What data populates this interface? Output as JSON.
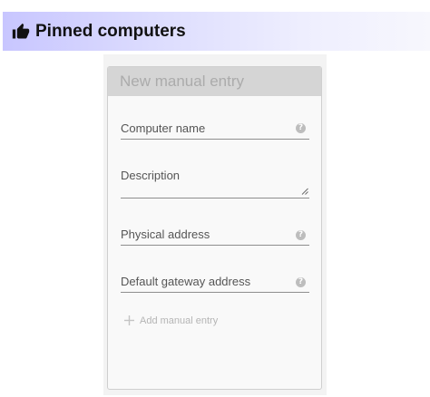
{
  "header": {
    "title": "Pinned computers",
    "icon": "thumbs-up-icon",
    "gradient_start": "#c8c6ff"
  },
  "card": {
    "title": "New manual entry",
    "fields": [
      {
        "label": "Computer name",
        "help_icon": "help-icon"
      },
      {
        "label": "Description",
        "resize_icon": "resize-handle-icon"
      },
      {
        "label": "Physical address",
        "help_icon": "help-icon"
      },
      {
        "label": "Default gateway address",
        "help_icon": "help-icon"
      }
    ],
    "help_glyph": "?",
    "add_button": {
      "label": "Add manual entry",
      "icon": "plus-icon"
    }
  }
}
